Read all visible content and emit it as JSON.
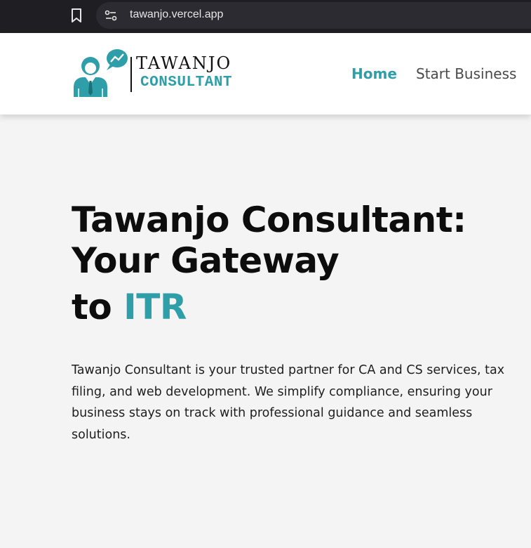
{
  "browser": {
    "url": "tawanjo.vercel.app",
    "icons": {
      "bookmark": "bookmark-icon",
      "site_info": "tune-icon"
    }
  },
  "header": {
    "logo": {
      "word1": "TAWANJO",
      "word2": "CONSULTANT",
      "graphic": "consultant-chat-icon"
    },
    "nav": {
      "home": "Home",
      "start_business": "Start Business"
    }
  },
  "hero": {
    "title_line1": "Tawanjo Consultant:",
    "title_line2": "Your Gateway",
    "title_line3_prefix": "to ",
    "title_line3_accent": "ITR",
    "description": "Tawanjo Consultant is your trusted partner for CA and CS services, tax filing, and web development. We simplify compliance, ensuring your business stays on track with professional guidance and seamless solutions."
  },
  "colors": {
    "accent": "#2e9ea9",
    "browser_bar": "#1f1f23",
    "page_bg": "#f4f4f4",
    "header_bg": "#ffffff"
  }
}
